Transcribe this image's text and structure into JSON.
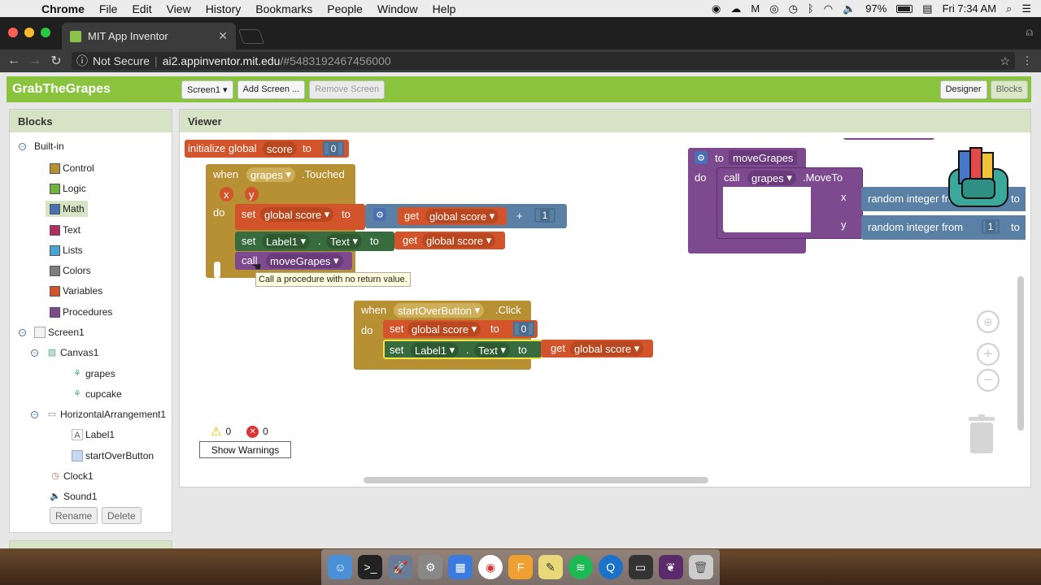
{
  "menubar": {
    "app": "Chrome",
    "items": [
      "File",
      "Edit",
      "View",
      "History",
      "Bookmarks",
      "People",
      "Window",
      "Help"
    ],
    "battery": "97%",
    "clock": "Fri 7:34 AM"
  },
  "browser": {
    "tab_title": "MIT App Inventor",
    "security": "Not Secure",
    "url_host": "ai2.appinventor.mit.edu",
    "url_path": "/#5483192467456000"
  },
  "app": {
    "project": "GrabTheGrapes",
    "screen_select": "Screen1 ▾",
    "add_screen": "Add Screen ...",
    "remove_screen": "Remove Screen",
    "designer": "Designer",
    "blocks": "Blocks"
  },
  "blocks_panel": {
    "title": "Blocks",
    "builtin": "Built-in",
    "categories": [
      {
        "label": "Control",
        "color": "#b69033"
      },
      {
        "label": "Logic",
        "color": "#70b23e"
      },
      {
        "label": "Math",
        "color": "#4a6fb5"
      },
      {
        "label": "Text",
        "color": "#b32d5e"
      },
      {
        "label": "Lists",
        "color": "#49a6d4"
      },
      {
        "label": "Colors",
        "color": "#7d7d7d"
      },
      {
        "label": "Variables",
        "color": "#d3542b"
      },
      {
        "label": "Procedures",
        "color": "#7d4a8f"
      }
    ],
    "screen": "Screen1",
    "components": {
      "canvas": "Canvas1",
      "grapes": "grapes",
      "cupcake": "cupcake",
      "harr": "HorizontalArrangement1",
      "label": "Label1",
      "button": "startOverButton",
      "clock": "Clock1",
      "sound": "Sound1"
    },
    "rename": "Rename",
    "delete": "Delete"
  },
  "viewer": {
    "title": "Viewer",
    "init_block": {
      "text": "initialize global",
      "name": "score",
      "to": "to",
      "value": "0"
    },
    "touched_block": {
      "when": "when",
      "component": "grapes",
      "event": ".Touched",
      "param_x": "x",
      "param_y": "y",
      "do": "do",
      "set1": {
        "set": "set",
        "var": "global score",
        "to": "to",
        "get": "get",
        "get_var": "global score",
        "op": "+",
        "num": "1"
      },
      "set2": {
        "set": "set",
        "comp": "Label1",
        "dot": ".",
        "prop": "Text",
        "to": "to",
        "get": "get",
        "get_var": "global score"
      },
      "call": {
        "call": "call",
        "proc": "moveGrapes"
      }
    },
    "tooltip": "Call a procedure with no return value.",
    "click_block": {
      "when": "when",
      "component": "startOverButton",
      "event": ".Click",
      "do": "do",
      "set1": {
        "set": "set",
        "var": "global score",
        "to": "to",
        "num": "0"
      },
      "set2": {
        "set": "set",
        "comp": "Label1",
        "dot": ".",
        "prop": "Text",
        "to": "to",
        "get": "get",
        "get_var": "global score"
      }
    },
    "proc_block": {
      "to": "to",
      "name": "moveGrapes",
      "do": "do",
      "call": "call",
      "comp": "grapes",
      "method": ".MoveTo",
      "x": "x",
      "y": "y",
      "rand1": "random integer from",
      "rand2": "random integer from",
      "num": "1",
      "to2": "to"
    },
    "warnings": "0",
    "errors": "0",
    "show_warnings": "Show Warnings"
  }
}
